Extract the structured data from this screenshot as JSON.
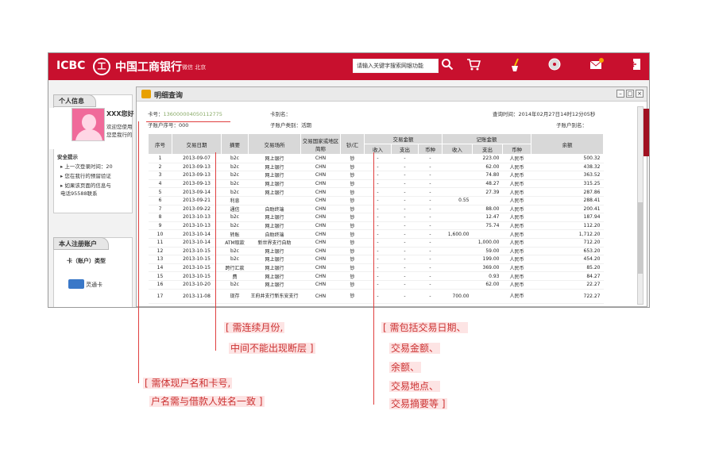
{
  "topbar": {
    "logo": "ICBC",
    "logo_mark": "工",
    "bank_name": "中国工商银行",
    "welcome": "微信  北京",
    "search_placeholder": "请输入关键字搜索网银功能",
    "icons": [
      "search-icon",
      "cart-icon",
      "broom-icon",
      "disc-icon",
      "mail-icon",
      "exit-icon"
    ]
  },
  "sidebar": {
    "personal_info_tab": "个人信息",
    "user_name": "XXX您好",
    "welcome_line1": "欢迎您使用",
    "welcome_line2": "您是我行的",
    "security_title": "安全提示",
    "security_items": [
      "上一次登录时间：20",
      "您在我行的预留验证",
      "如果该页面的信息与",
      "电话95588联系"
    ],
    "accounts_tab": "本人注册账户",
    "card_type_label": "卡（账户）类型",
    "card_name": "灵通卡"
  },
  "window": {
    "title": "明细查询",
    "card_no_label": "卡号：",
    "card_no": "136000004050112775",
    "card_alias_label": "卡别名：",
    "query_time": "查询时间：2014年02月27日14时12分05秒",
    "sub_acct_no": "子账户序号：000",
    "sub_acct_type": "子账户类别：活期",
    "sub_acct_alias": "子账户别名："
  },
  "table": {
    "headers_top": [
      "序号",
      "交易日期",
      "摘要",
      "交易场所",
      "交易国家或地区简称",
      "钞/汇",
      "交易金额",
      "记账金额",
      "余额"
    ],
    "headers_sub": [
      "收入",
      "支出",
      "币种",
      "收入",
      "支出",
      "币种"
    ],
    "rows": [
      [
        "1",
        "2013-09-07",
        "b2c",
        "网上银行",
        "CHN",
        "钞",
        "-",
        "-",
        "-",
        "",
        "223.00",
        "人民币",
        "500.32"
      ],
      [
        "2",
        "2013-09-13",
        "b2c",
        "网上银行",
        "CHN",
        "钞",
        "-",
        "-",
        "-",
        "",
        "62.00",
        "人民币",
        "438.32"
      ],
      [
        "3",
        "2013-09-13",
        "b2c",
        "网上银行",
        "CHN",
        "钞",
        "-",
        "-",
        "-",
        "",
        "74.80",
        "人民币",
        "363.52"
      ],
      [
        "4",
        "2013-09-13",
        "b2c",
        "网上银行",
        "CHN",
        "钞",
        "-",
        "-",
        "-",
        "",
        "48.27",
        "人民币",
        "315.25"
      ],
      [
        "5",
        "2013-09-14",
        "b2c",
        "网上银行",
        "CHN",
        "钞",
        "-",
        "-",
        "-",
        "",
        "27.39",
        "人民币",
        "287.86"
      ],
      [
        "6",
        "2013-09-21",
        "利息",
        "",
        "CHN",
        "钞",
        "-",
        "-",
        "-",
        "0.55",
        "",
        "人民币",
        "288.41"
      ],
      [
        "7",
        "2013-09-22",
        "通信",
        "自助终端",
        "CHN",
        "钞",
        "-",
        "-",
        "-",
        "",
        "88.00",
        "人民币",
        "200.41"
      ],
      [
        "8",
        "2013-10-13",
        "b2c",
        "网上银行",
        "CHN",
        "钞",
        "-",
        "-",
        "-",
        "",
        "12.47",
        "人民币",
        "187.94"
      ],
      [
        "9",
        "2013-10-13",
        "b2c",
        "网上银行",
        "CHN",
        "钞",
        "-",
        "-",
        "-",
        "",
        "75.74",
        "人民币",
        "112.20"
      ],
      [
        "10",
        "2013-10-14",
        "转账",
        "自助终端",
        "CHN",
        "钞",
        "-",
        "-",
        "-",
        "1,600.00",
        "",
        "人民币",
        "1,712.20"
      ],
      [
        "11",
        "2013-10-14",
        "ATM取款",
        "新世界支行自助",
        "CHN",
        "钞",
        "-",
        "-",
        "-",
        "",
        "1,000.00",
        "人民币",
        "712.20"
      ],
      [
        "12",
        "2013-10-15",
        "b2c",
        "网上银行",
        "CHN",
        "钞",
        "-",
        "-",
        "-",
        "",
        "59.00",
        "人民币",
        "653.20"
      ],
      [
        "13",
        "2013-10-15",
        "b2c",
        "网上银行",
        "CHN",
        "钞",
        "-",
        "-",
        "-",
        "",
        "199.00",
        "人民币",
        "454.20"
      ],
      [
        "14",
        "2013-10-15",
        "跨行汇款",
        "网上银行",
        "CHN",
        "钞",
        "-",
        "-",
        "-",
        "",
        "369.00",
        "人民币",
        "85.20"
      ],
      [
        "15",
        "2013-10-15",
        "费",
        "网上银行",
        "CHN",
        "钞",
        "-",
        "-",
        "-",
        "",
        "0.93",
        "人民币",
        "84.27"
      ],
      [
        "16",
        "2013-10-20",
        "b2c",
        "网上银行",
        "CHN",
        "钞",
        "-",
        "-",
        "-",
        "",
        "62.00",
        "人民币",
        "22.27"
      ],
      [
        "17",
        "2013-11-08",
        "现存",
        "王府井支行新东安支行",
        "CHN",
        "钞",
        "-",
        "-",
        "-",
        "700.00",
        "",
        "人民币",
        "722.27"
      ]
    ]
  },
  "annotations": {
    "a1_line1": "[ 需连续月份,",
    "a1_line2": "中间不能出现断层 ]",
    "a2_line1": "[ 需包括交易日期、",
    "a2_line2": "交易金额、",
    "a2_line3": "余额、",
    "a2_line4": "交易地点、",
    "a2_line5": "交易摘要等 ]",
    "a3_line1": "[ 需体现户名和卡号,",
    "a3_line2": "户名需与借款人姓名一致 ]"
  },
  "colors": {
    "brand": "#c8102e",
    "annotation": "#cc3333"
  }
}
